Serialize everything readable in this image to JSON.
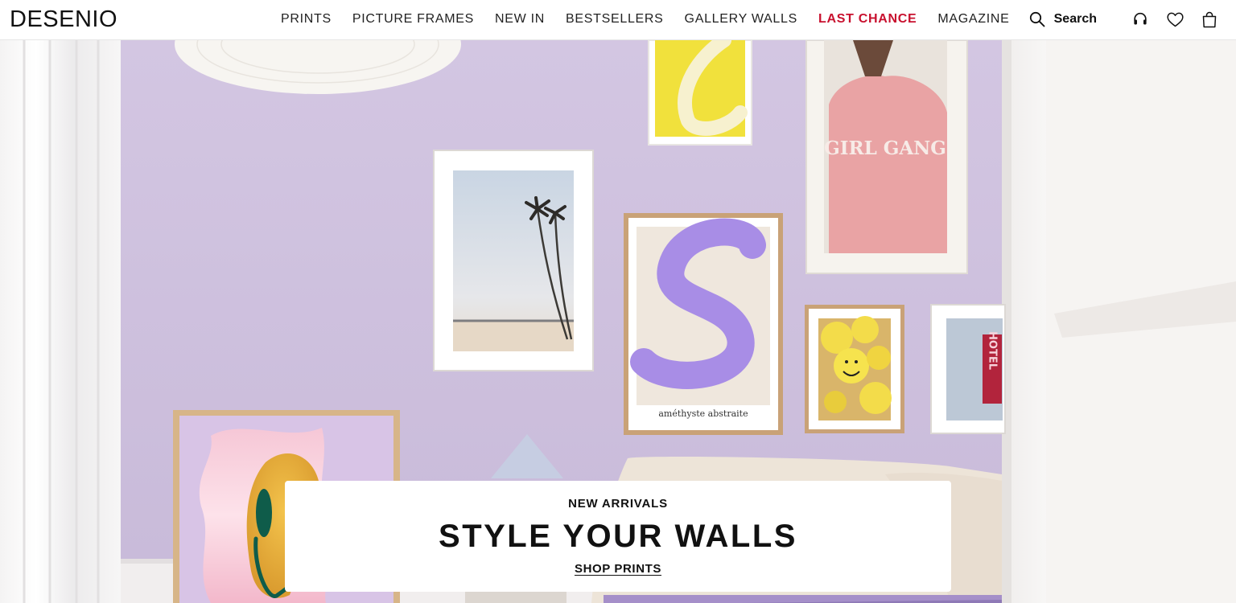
{
  "header": {
    "logo": "DESENIO",
    "nav": [
      {
        "label": "PRINTS"
      },
      {
        "label": "PICTURE FRAMES"
      },
      {
        "label": "NEW IN"
      },
      {
        "label": "BESTSELLERS"
      },
      {
        "label": "GALLERY WALLS"
      },
      {
        "label": "LAST CHANCE"
      },
      {
        "label": "MAGAZINE"
      }
    ],
    "search_label": "Search",
    "sale_color": "#c8102e"
  },
  "hero": {
    "eyebrow": "NEW ARRIVALS",
    "title": "STYLE YOUR WALLS",
    "cta": "SHOP PRINTS",
    "poster_text_jacket": "GIRL GANG",
    "poster_text_abstract": "améthyste abstraite",
    "poster_text_hotel": "HOTEL",
    "wall_color": "#cdbfdd"
  },
  "icons": {
    "search": "search-icon",
    "support": "headset-icon",
    "wishlist": "heart-icon",
    "cart": "bag-icon"
  }
}
